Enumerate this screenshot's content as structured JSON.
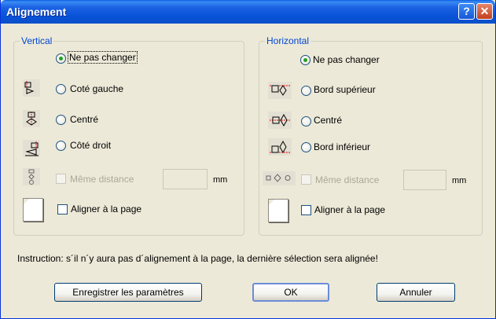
{
  "window": {
    "title": "Alignement",
    "help_glyph": "?",
    "close_glyph": "✕"
  },
  "vertical": {
    "legend": "Vertical",
    "options": [
      {
        "label": "Ne pas changer",
        "checked": true,
        "icon": "none"
      },
      {
        "label": "Coté gauche",
        "checked": false,
        "icon": "align-left-icon"
      },
      {
        "label": "Centré",
        "checked": false,
        "icon": "align-center-icon"
      },
      {
        "label": "Côté droit",
        "checked": false,
        "icon": "align-right-icon"
      }
    ],
    "same_distance": {
      "label": "Même distance",
      "unit": "mm",
      "value": "",
      "enabled": false
    },
    "align_page": {
      "label": "Aligner à la page",
      "checked": false
    }
  },
  "horizontal": {
    "legend": "Horizontal",
    "options": [
      {
        "label": "Ne pas changer",
        "checked": true,
        "icon": "none"
      },
      {
        "label": "Bord supérieur",
        "checked": false,
        "icon": "align-top-icon"
      },
      {
        "label": "Centré",
        "checked": false,
        "icon": "align-middle-icon"
      },
      {
        "label": "Bord inférieur",
        "checked": false,
        "icon": "align-bottom-icon"
      }
    ],
    "same_distance": {
      "label": "Même distance",
      "unit": "mm",
      "value": "",
      "enabled": false
    },
    "align_page": {
      "label": "Aligner à la page",
      "checked": false
    }
  },
  "instruction": "Instruction: s´il n´y aura pas d´alignement à la page, la dernière sélection sera alignée!",
  "buttons": {
    "save": "Enregistrer les paramètres",
    "ok": "OK",
    "cancel": "Annuler"
  }
}
